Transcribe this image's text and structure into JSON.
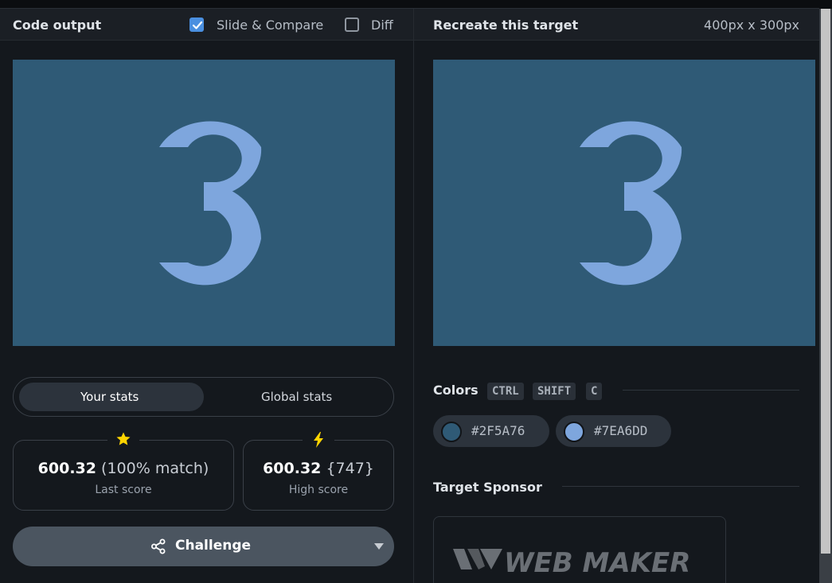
{
  "left_panel": {
    "title": "Code output",
    "slide_compare": {
      "label": "Slide & Compare",
      "checked": true
    },
    "diff": {
      "label": "Diff",
      "checked": false
    },
    "canvas": {
      "bg": "#2F5A76",
      "fg": "#7EA6DD",
      "glyph": "3"
    },
    "stats_toggle": {
      "your": "Your stats",
      "global": "Global stats",
      "active": "your"
    },
    "last_score": {
      "icon": "star-icon",
      "value": "600.32",
      "detail": "(100% match)",
      "label": "Last score"
    },
    "high_score": {
      "icon": "bolt-icon",
      "value": "600.32",
      "detail": "{747}",
      "label": "High score"
    },
    "challenge": {
      "label": "Challenge",
      "icon": "share-icon"
    }
  },
  "right_panel": {
    "title": "Recreate this target",
    "dimensions": "400px x 300px",
    "canvas": {
      "bg": "#2F5A76",
      "fg": "#7EA6DD",
      "glyph": "3"
    },
    "colors": {
      "title": "Colors",
      "shortcut": [
        "CTRL",
        "SHIFT",
        "C"
      ],
      "swatches": [
        {
          "hex": "#2F5A76"
        },
        {
          "hex": "#7EA6DD"
        }
      ]
    },
    "sponsor": {
      "title": "Target Sponsor",
      "name": "WEB MAKER"
    }
  },
  "colors": {
    "accent": "#4a8fe0",
    "star": "#ffd400",
    "bolt": "#ffd400"
  }
}
